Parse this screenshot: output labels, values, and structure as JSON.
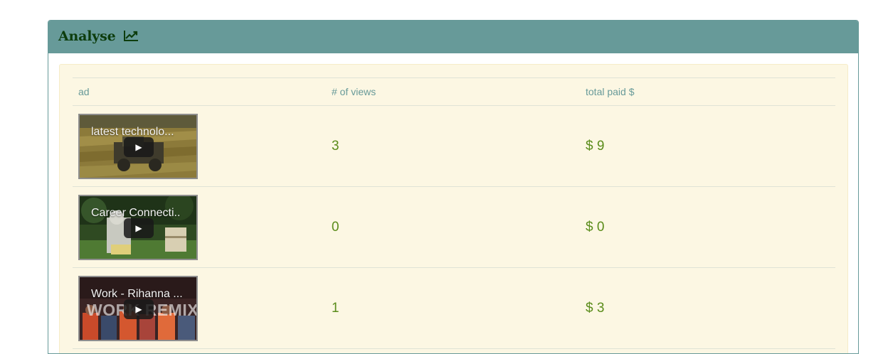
{
  "panel": {
    "title": "Analyse",
    "icon": "line-chart-icon"
  },
  "table": {
    "headers": {
      "ad": "ad",
      "views": "# of views",
      "paid": "total paid $"
    },
    "rows": [
      {
        "ad_title": "latest technolo...",
        "watermark": "",
        "views": "3",
        "paid": "$ 9",
        "thumbnail": "harvester-field-thumbnail"
      },
      {
        "ad_title": "Career Connecti..",
        "watermark": "",
        "views": "0",
        "paid": "$ 0",
        "thumbnail": "beekeeper-thumbnail"
      },
      {
        "ad_title": "Work - Rihanna ...",
        "watermark": "WORK REMIX",
        "views": "1",
        "paid": "$ 3",
        "thumbnail": "dancers-thumbnail"
      }
    ]
  },
  "colors": {
    "header_bg": "#679a99",
    "title_text": "#0d3d0d",
    "body_bg": "#fcf7e3",
    "value_text": "#5a8c1a"
  }
}
